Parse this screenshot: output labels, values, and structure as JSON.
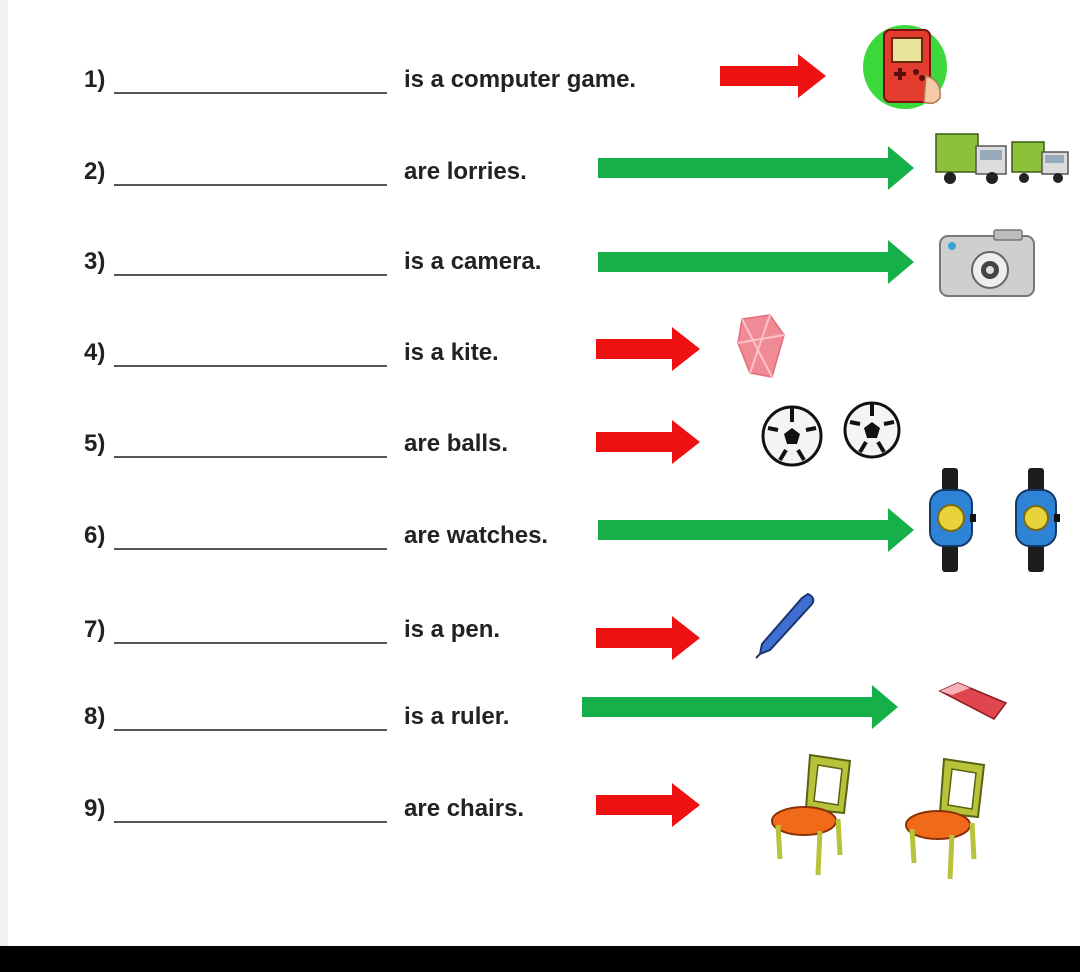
{
  "worksheet": {
    "items": [
      {
        "number": "1)",
        "phrase": "is a computer game.",
        "arrow_color": "red",
        "picture": "handheld-game-icon"
      },
      {
        "number": "2)",
        "phrase": "are lorries.",
        "arrow_color": "green",
        "picture": "lorries-icon"
      },
      {
        "number": "3)",
        "phrase": "is a camera.",
        "arrow_color": "green",
        "picture": "camera-icon"
      },
      {
        "number": "4)",
        "phrase": "is a kite.",
        "arrow_color": "red",
        "picture": "kite-icon"
      },
      {
        "number": "5)",
        "phrase": "are balls.",
        "arrow_color": "red",
        "picture": "soccer-balls-icon"
      },
      {
        "number": "6)",
        "phrase": "are watches.",
        "arrow_color": "green",
        "picture": "watches-icon"
      },
      {
        "number": "7)",
        "phrase": "is a pen.",
        "arrow_color": "red",
        "picture": "pen-icon"
      },
      {
        "number": "8)",
        "phrase": "is a ruler.",
        "arrow_color": "green",
        "picture": "ruler-icon"
      },
      {
        "number": "9)",
        "phrase": "are chairs.",
        "arrow_color": "red",
        "picture": "chairs-icon"
      }
    ]
  },
  "colors": {
    "red_arrow": "#ee1111",
    "green_arrow": "#16b04a",
    "text": "#222222"
  }
}
